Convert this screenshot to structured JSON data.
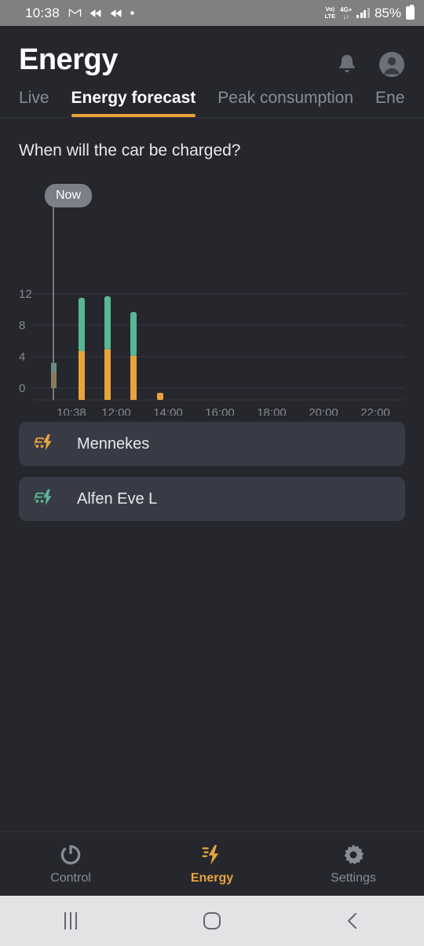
{
  "statusbar": {
    "time": "10:38",
    "mail_icon": "gmail-icon",
    "rewind_icon_1": "rewind-icon",
    "rewind_icon_2": "rewind-icon",
    "dot_icon": "dot-icon",
    "volte_line1": "Vo)",
    "volte_line2": "LTE",
    "network_type": "4G+",
    "data_arrows": "↓↑",
    "signal_icon": "signal-bars-icon",
    "battery_percent": "85%",
    "battery_icon": "battery-icon"
  },
  "header": {
    "title": "Energy",
    "notifications_icon": "bell-icon",
    "account_icon": "avatar-icon"
  },
  "tabs": [
    {
      "label": "Live",
      "active": false
    },
    {
      "label": "Energy forecast",
      "active": true
    },
    {
      "label": "Peak consumption",
      "active": false
    },
    {
      "label": "Ene",
      "active": false
    }
  ],
  "main": {
    "section_title": "When will the car be charged?",
    "now_label": "Now"
  },
  "chart_data": {
    "type": "bar",
    "title": "When will the car be charged?",
    "xlabel": "",
    "ylabel": "",
    "ylim": [
      -2,
      14
    ],
    "yticks": [
      0,
      4,
      8,
      12
    ],
    "ytick_labels": [
      "0",
      "4",
      "8",
      "12"
    ],
    "xtick_labels": [
      "10:38",
      "12:00",
      "14:00",
      "16:00",
      "18:00",
      "20:00",
      "22:00"
    ],
    "xlim_labels": [
      "10:38",
      "23:00"
    ],
    "grid": true,
    "legend": "none",
    "stacked": true,
    "now_marker": "10:38",
    "series": [
      {
        "name": "Mennekes",
        "color": "#e8a33d",
        "values": [
          2.0,
          4.8,
          5.0,
          4.2,
          0.4,
          0,
          0,
          0,
          0,
          0,
          0,
          0,
          0
        ]
      },
      {
        "name": "Alfen Eve L",
        "color": "#57b894",
        "values": [
          1.2,
          6.7,
          6.7,
          5.4,
          0,
          0,
          0,
          0,
          0,
          0,
          0,
          0,
          0
        ]
      }
    ],
    "bars": [
      {
        "x": "10:38",
        "orange": 2.0,
        "green": 1.2,
        "muted": true
      },
      {
        "x": "11:00",
        "orange": 4.8,
        "green": 6.7,
        "muted": false
      },
      {
        "x": "12:00",
        "orange": 5.0,
        "green": 6.7,
        "muted": false
      },
      {
        "x": "12:45",
        "orange": 4.2,
        "green": 5.4,
        "muted": false
      },
      {
        "x": "13:45",
        "orange": 0.4,
        "green": 0,
        "muted": false
      }
    ]
  },
  "devices": [
    {
      "name": "Mennekes",
      "icon": "ev-charger-icon",
      "color": "#e8a33d"
    },
    {
      "name": "Alfen Eve L",
      "icon": "ev-charger-icon",
      "color": "#57b894"
    }
  ],
  "bottom_nav": [
    {
      "label": "Control",
      "icon": "power-refresh-icon",
      "active": false
    },
    {
      "label": "Energy",
      "icon": "energy-bolt-icon",
      "active": true
    },
    {
      "label": "Settings",
      "icon": "gear-icon",
      "active": false
    }
  ],
  "system_nav": {
    "recents_icon": "recents-icon",
    "home_icon": "home-icon",
    "back_icon": "back-icon"
  },
  "colors": {
    "accent": "#e8a33d",
    "green": "#57b894",
    "background": "#26272d",
    "card": "#383b45"
  }
}
